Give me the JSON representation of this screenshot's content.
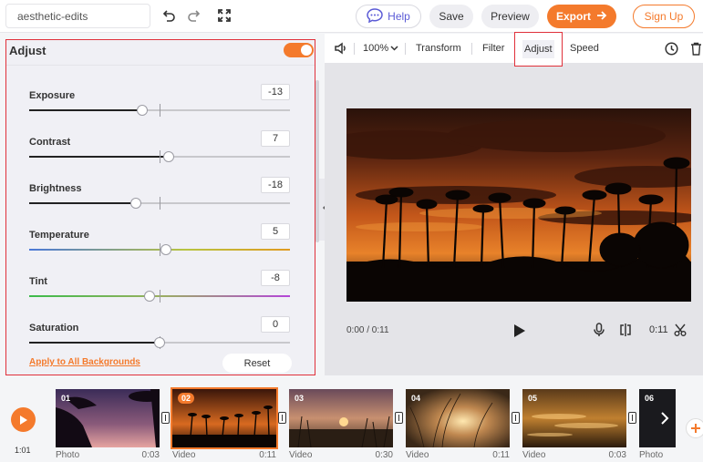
{
  "topbar": {
    "project_name": "aesthetic-edits",
    "help_label": "Help",
    "save_label": "Save",
    "preview_label": "Preview",
    "export_label": "Export",
    "signup_label": "Sign Up",
    "icons": [
      "undo-icon",
      "redo-icon",
      "fullscreen-icon"
    ]
  },
  "adjust_panel": {
    "title": "Adjust",
    "enabled": true,
    "sliders": [
      {
        "label": "Exposure",
        "value": "-13",
        "level": 0.435
      },
      {
        "label": "Contrast",
        "value": "7",
        "level": 0.535
      },
      {
        "label": "Brightness",
        "value": "-18",
        "level": 0.41
      },
      {
        "label": "Temperature",
        "value": "5",
        "level": 0.525
      },
      {
        "label": "Tint",
        "value": "-8",
        "level": 0.46
      },
      {
        "label": "Saturation",
        "value": "0",
        "level": 0.5
      }
    ],
    "apply_all_label": "Apply to All Backgrounds",
    "reset_label": "Reset"
  },
  "editor": {
    "zoom_label": "100%",
    "tabs": {
      "transform": "Transform",
      "filter": "Filter",
      "adjust": "Adjust",
      "speed": "Speed"
    },
    "active_tab": "Adjust",
    "playback_time": "0:00 / 0:11",
    "duration": "0:11"
  },
  "timeline": {
    "total_time": "1:01",
    "clips": [
      {
        "num": "01",
        "type": "Photo",
        "duration": "0:03",
        "selected": false
      },
      {
        "num": "02",
        "type": "Video",
        "duration": "0:11",
        "selected": true
      },
      {
        "num": "03",
        "type": "Video",
        "duration": "0:30",
        "selected": false
      },
      {
        "num": "04",
        "type": "Video",
        "duration": "0:11",
        "selected": false
      },
      {
        "num": "05",
        "type": "Video",
        "duration": "0:03",
        "selected": false
      },
      {
        "num": "06",
        "type": "Photo",
        "duration": "",
        "selected": false
      }
    ]
  },
  "colors": {
    "accent": "#f47a2c",
    "highlight": "#e0303a",
    "help": "#5b5bd6"
  }
}
